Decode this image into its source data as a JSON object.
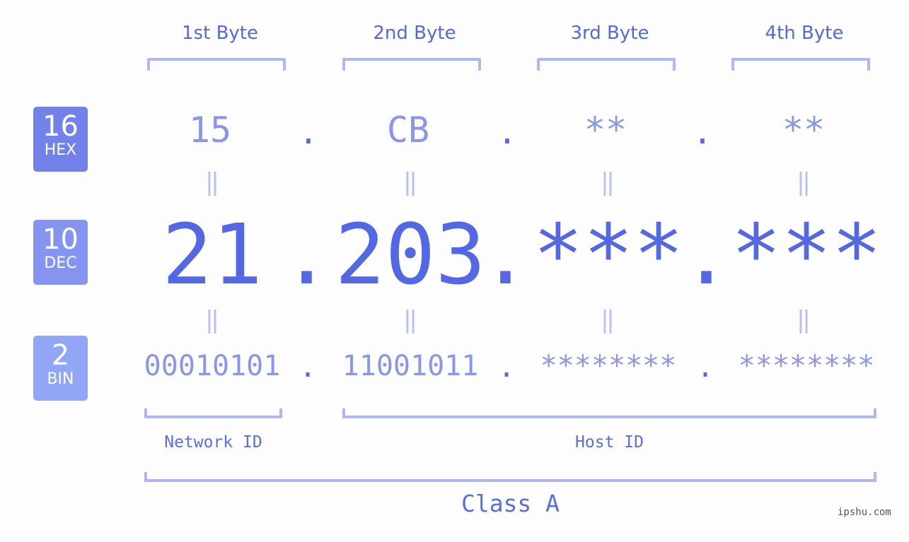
{
  "headers": [
    "1st Byte",
    "2nd Byte",
    "3rd Byte",
    "4th Byte"
  ],
  "badges": {
    "hex": {
      "num": "16",
      "label": "HEX",
      "color": "#7282ea"
    },
    "dec": {
      "num": "10",
      "label": "DEC",
      "color": "#8494f0"
    },
    "bin": {
      "num": "2",
      "label": "BIN",
      "color": "#92a6f8"
    }
  },
  "hex": [
    "15",
    "CB",
    "**",
    "**"
  ],
  "dec": [
    "21",
    "203",
    "***",
    "***"
  ],
  "bin": [
    "00010101",
    "11001011",
    "********",
    "********"
  ],
  "separator": ".",
  "equals": "=",
  "network_label": "Network ID",
  "host_label": "Host ID",
  "class_label": "Class A",
  "watermark": "ipshu.com"
}
